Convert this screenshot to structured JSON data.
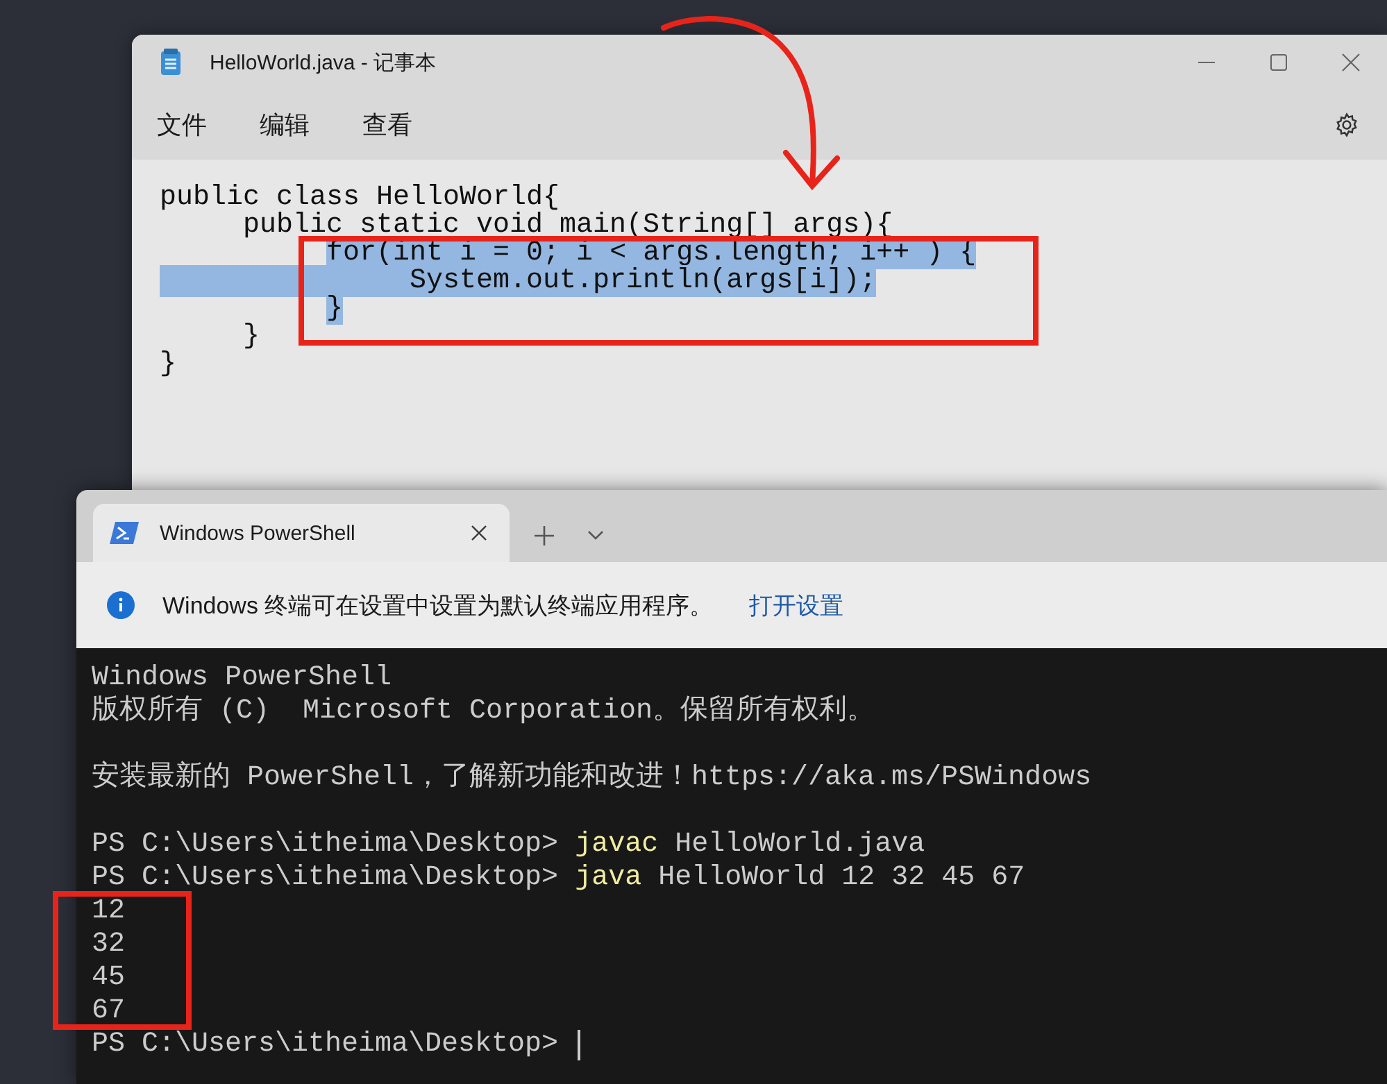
{
  "notepad": {
    "title": "HelloWorld.java - 记事本",
    "menu": [
      "文件",
      "编辑",
      "查看"
    ],
    "lines": [
      {
        "text": "public class HelloWorld{",
        "selected": false,
        "selected_from_margin": false
      },
      {
        "text": "     public static void main(String[] args){",
        "selected": false,
        "selected_from_margin": false
      },
      {
        "text": "          for(int i = 0; i < args.length; i++ ) {",
        "selected": true,
        "selected_from_margin": false
      },
      {
        "text": "               System.out.println(args[i]);",
        "selected": true,
        "selected_from_margin": true
      },
      {
        "text": "          }",
        "selected": true,
        "selected_from_margin": false
      },
      {
        "text": "     }",
        "selected": false,
        "selected_from_margin": false
      },
      {
        "text": "}",
        "selected": false,
        "selected_from_margin": false
      }
    ]
  },
  "terminal": {
    "tab": {
      "title": "Windows PowerShell",
      "selected": true
    },
    "info": {
      "message": "Windows 终端可在设置中设置为默认终端应用程序。",
      "link": "打开设置"
    },
    "lines": [
      {
        "kind": "text",
        "segments": [
          {
            "text": "Windows PowerShell",
            "kind": "plain"
          }
        ]
      },
      {
        "kind": "text",
        "segments": [
          {
            "text": "版权所有 (C)  Microsoft Corporation。保留所有权利。",
            "kind": "plain"
          }
        ]
      },
      {
        "kind": "blank"
      },
      {
        "kind": "text",
        "segments": [
          {
            "text": "安装最新的 PowerShell，了解新功能和改进！https://aka.ms/PSWindows",
            "kind": "plain"
          }
        ]
      },
      {
        "kind": "blank"
      },
      {
        "kind": "text",
        "segments": [
          {
            "text": "PS C:\\Users\\itheima\\Desktop> ",
            "kind": "plain"
          },
          {
            "text": "javac",
            "kind": "command"
          },
          {
            "text": " HelloWorld.java",
            "kind": "plain"
          }
        ]
      },
      {
        "kind": "text",
        "segments": [
          {
            "text": "PS C:\\Users\\itheima\\Desktop> ",
            "kind": "plain"
          },
          {
            "text": "java",
            "kind": "command"
          },
          {
            "text": " HelloWorld 12 32 45 67",
            "kind": "plain"
          }
        ]
      },
      {
        "kind": "text",
        "segments": [
          {
            "text": "12",
            "kind": "plain"
          }
        ]
      },
      {
        "kind": "text",
        "segments": [
          {
            "text": "32",
            "kind": "plain"
          }
        ]
      },
      {
        "kind": "text",
        "segments": [
          {
            "text": "45",
            "kind": "plain"
          }
        ]
      },
      {
        "kind": "text",
        "segments": [
          {
            "text": "67",
            "kind": "plain"
          }
        ]
      },
      {
        "kind": "prompt",
        "segments": [
          {
            "text": "PS C:\\Users\\itheima\\Desktop> ",
            "kind": "plain"
          }
        ]
      }
    ]
  },
  "annotations": [
    {
      "kind": "arrow"
    },
    {
      "kind": "box"
    },
    {
      "kind": "box"
    }
  ]
}
